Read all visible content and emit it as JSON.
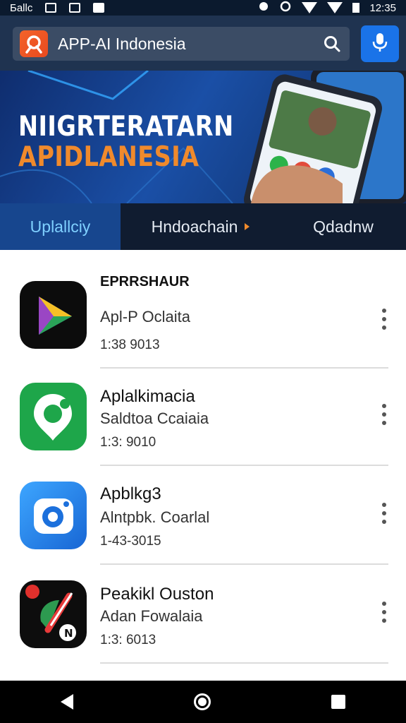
{
  "status_bar": {
    "left_text": "Баllс",
    "time": "12:35",
    "icons": [
      "check-box-icon",
      "mail-icon",
      "message-icon",
      "notification-icon",
      "sync-icon",
      "wifi-icon",
      "battery-icon"
    ]
  },
  "header": {
    "search_value": "APP-AI Indonesia",
    "search_icon": "search-icon",
    "mic_icon": "microphone-icon",
    "accent_color": "#1a73e8"
  },
  "banner": {
    "line1": "NIIGRTERATARN",
    "line2": "APIDLANESIA",
    "line2_color": "#f08a2c"
  },
  "tabs": [
    {
      "label": "Uplallciy",
      "active": true
    },
    {
      "label": "Hndoachain",
      "active": false
    },
    {
      "label": "Qdadnw",
      "active": false
    }
  ],
  "list": {
    "section_title": "EPRRSHAUR",
    "items": [
      {
        "name": "",
        "subtitle": "Apl-P Oclaita",
        "meta": "1:38 9013",
        "icon": "play-triangle-icon"
      },
      {
        "name": "Aplalkimacia",
        "subtitle": "Saldtoa Ccaiaia",
        "meta": "1:3: 9010",
        "icon": "map-pin-icon"
      },
      {
        "name": "Apblkg3",
        "subtitle": "Alntpbk. Coarlal",
        "meta": "1-43-3015",
        "icon": "camera-icon"
      },
      {
        "name": "Peakikl Ouston",
        "subtitle": "Adan Fowalaia",
        "meta": "1:3: 6013",
        "icon": "pen-icon"
      }
    ]
  },
  "navbar": {
    "back_icon": "back-icon",
    "home_icon": "home-icon",
    "recents_icon": "recents-icon"
  }
}
